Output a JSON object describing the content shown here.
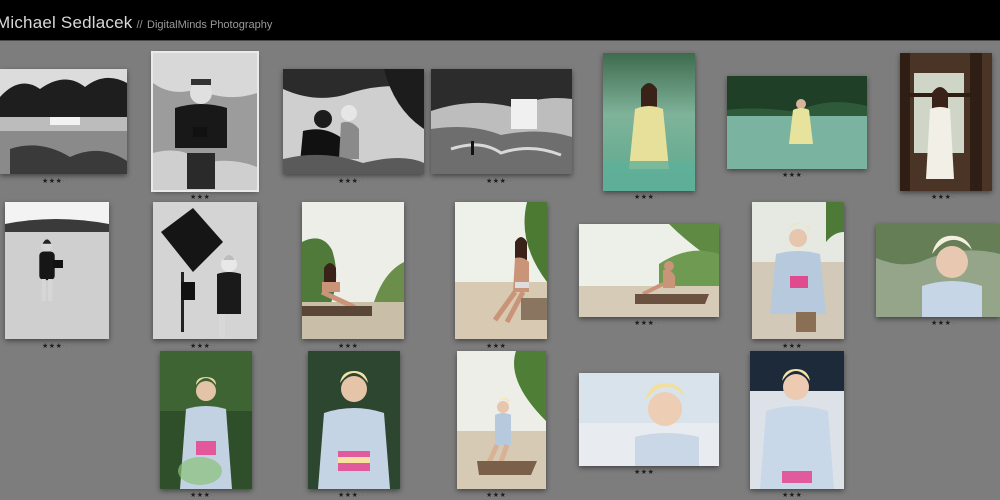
{
  "header": {
    "name": "Michael Sedlacek",
    "separator": "//",
    "studio": "DigitalMinds Photography"
  },
  "gallery": {
    "selected_index": 1,
    "rating_glyph_on": "★",
    "rating_glyph_off": "·",
    "max_rating": 5,
    "photos": [
      {
        "title": "waterfall-landscape-bw",
        "rating": 3
      },
      {
        "title": "photographer-on-rocks-bw",
        "rating": 3
      },
      {
        "title": "model-makeup-at-river-bw",
        "rating": 3
      },
      {
        "title": "river-cascade-bw",
        "rating": 3
      },
      {
        "title": "woman-yellow-dress-in-water",
        "rating": 3
      },
      {
        "title": "woman-standing-in-lake",
        "rating": 3
      },
      {
        "title": "woman-white-dress-by-window",
        "rating": 3
      },
      {
        "title": "photographer-standing-in-river-bw",
        "rating": 3
      },
      {
        "title": "studio-softbox-setup-bw",
        "rating": 3
      },
      {
        "title": "bikini-model-on-log",
        "rating": 3
      },
      {
        "title": "bikini-model-sitting-on-beach",
        "rating": 3
      },
      {
        "title": "model-reclining-on-log",
        "rating": 3
      },
      {
        "title": "blonde-model-denim-shirt-beach",
        "rating": 3
      },
      {
        "title": "blonde-model-portrait-close-up",
        "rating": 3
      },
      {
        "title": "blonde-model-in-greenery",
        "rating": 3
      },
      {
        "title": "blonde-model-denim-portrait",
        "rating": 3
      },
      {
        "title": "blonde-model-on-driftwood",
        "rating": 3
      },
      {
        "title": "blonde-model-headshot-light",
        "rating": 3
      },
      {
        "title": "blonde-model-denim-bikini",
        "rating": 3
      }
    ]
  }
}
